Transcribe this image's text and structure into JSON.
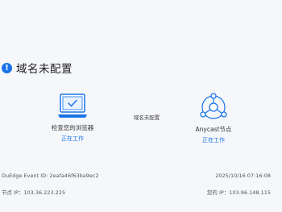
{
  "header": {
    "alert_icon_glyph": "!",
    "title": "域名未配置"
  },
  "nodes": {
    "browser": {
      "icon": "laptop-check-icon",
      "label": "检查您的浏览器",
      "status": "正在工作"
    },
    "middle": {
      "label": "域名未配置"
    },
    "anycast": {
      "icon": "anycast-network-icon",
      "label": "Anycast节点",
      "status": "正在工作"
    }
  },
  "footer": {
    "event_id": "DuEdge Event ID: 2eafa46f63ba9ec2",
    "timestamp": "2025/10/16 07:16:08",
    "node_ip": "节点 IP：103.36.223.225",
    "your_ip": "您的 IP：103.96.148.115"
  },
  "colors": {
    "accent": "#1a73e8",
    "background": "#f5f7fa"
  }
}
